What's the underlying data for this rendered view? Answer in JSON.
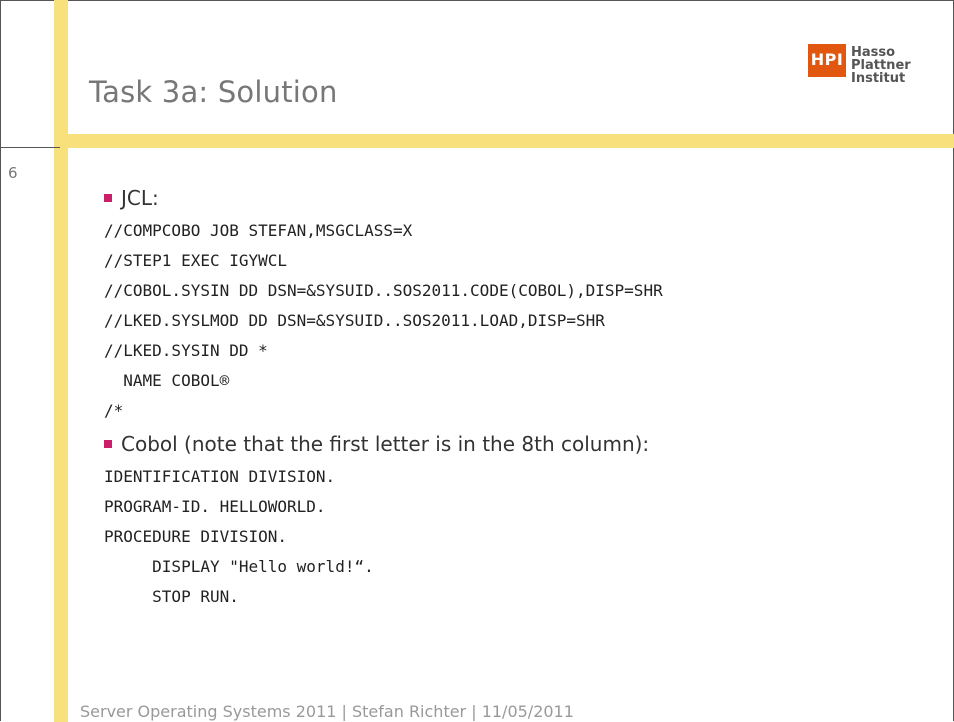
{
  "slide": {
    "number": "6",
    "title": "Task 3a: Solution",
    "logo": {
      "badge": "HPI",
      "lines": [
        "Hasso",
        "Plattner",
        "Institut"
      ]
    },
    "sections": [
      {
        "bullet": "JCL:",
        "code": [
          "//COMPCOBO JOB STEFAN,MSGCLASS=X",
          "//STEP1 EXEC IGYWCL",
          "//COBOL.SYSIN DD DSN=&SYSUID..SOS2011.CODE(COBOL),DISP=SHR",
          "//LKED.SYSLMOD DD DSN=&SYSUID..SOS2011.LOAD,DISP=SHR",
          "//LKED.SYSIN DD *",
          "  NAME COBOL®",
          "/*"
        ]
      },
      {
        "bullet": "Cobol (note that the first letter is in the 8th column):",
        "code": [
          "IDENTIFICATION DIVISION.",
          "PROGRAM-ID. HELLOWORLD.",
          "PROCEDURE DIVISION.",
          "     DISPLAY \"Hello world!“.",
          "     STOP RUN."
        ]
      }
    ],
    "footer": "Server Operating Systems 2011 | Stefan Richter | 11/05/2011",
    "colors": {
      "accent_bar": "#f8e07c",
      "bullet": "#cc1f6a",
      "logo": "#e2570f"
    }
  }
}
